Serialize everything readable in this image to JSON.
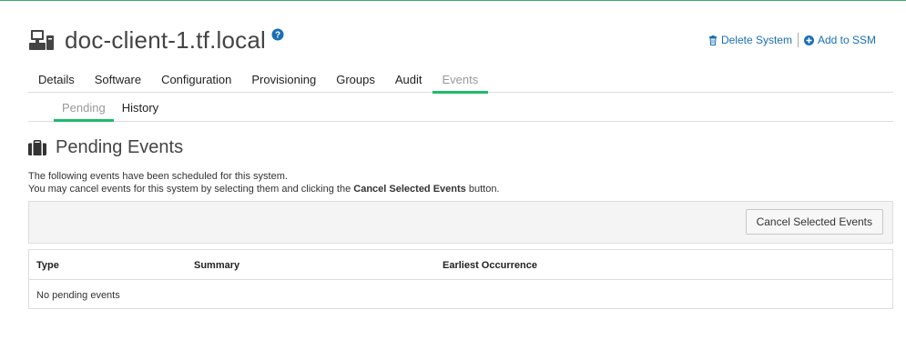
{
  "header": {
    "system_name": "doc-client-1.tf.local",
    "icons": {
      "system": "desktop-computer-icon",
      "help": "question-circle-icon"
    }
  },
  "actions": {
    "delete_label": "Delete System",
    "add_ssm_label": "Add to SSM",
    "icons": {
      "delete": "trash-icon",
      "add": "plus-circle-icon"
    }
  },
  "tabs": [
    {
      "label": "Details"
    },
    {
      "label": "Software"
    },
    {
      "label": "Configuration"
    },
    {
      "label": "Provisioning"
    },
    {
      "label": "Groups"
    },
    {
      "label": "Audit"
    },
    {
      "label": "Events",
      "active": true
    }
  ],
  "subtabs": [
    {
      "label": "Pending",
      "active": true
    },
    {
      "label": "History"
    }
  ],
  "section": {
    "title": "Pending Events",
    "icon": "briefcase-icon",
    "desc_line1": "The following events have been scheduled for this system.",
    "desc_line2_prefix": "You may cancel events for this system by selecting them and clicking the ",
    "desc_line2_bold": "Cancel Selected Events",
    "desc_line2_suffix": " button."
  },
  "toolbar": {
    "cancel_button_label": "Cancel Selected Events"
  },
  "table": {
    "columns": [
      "Type",
      "Summary",
      "Earliest Occurrence"
    ],
    "empty_message": "No pending events"
  },
  "colors": {
    "accent": "#1fba6c",
    "link": "#1a6fb3"
  }
}
